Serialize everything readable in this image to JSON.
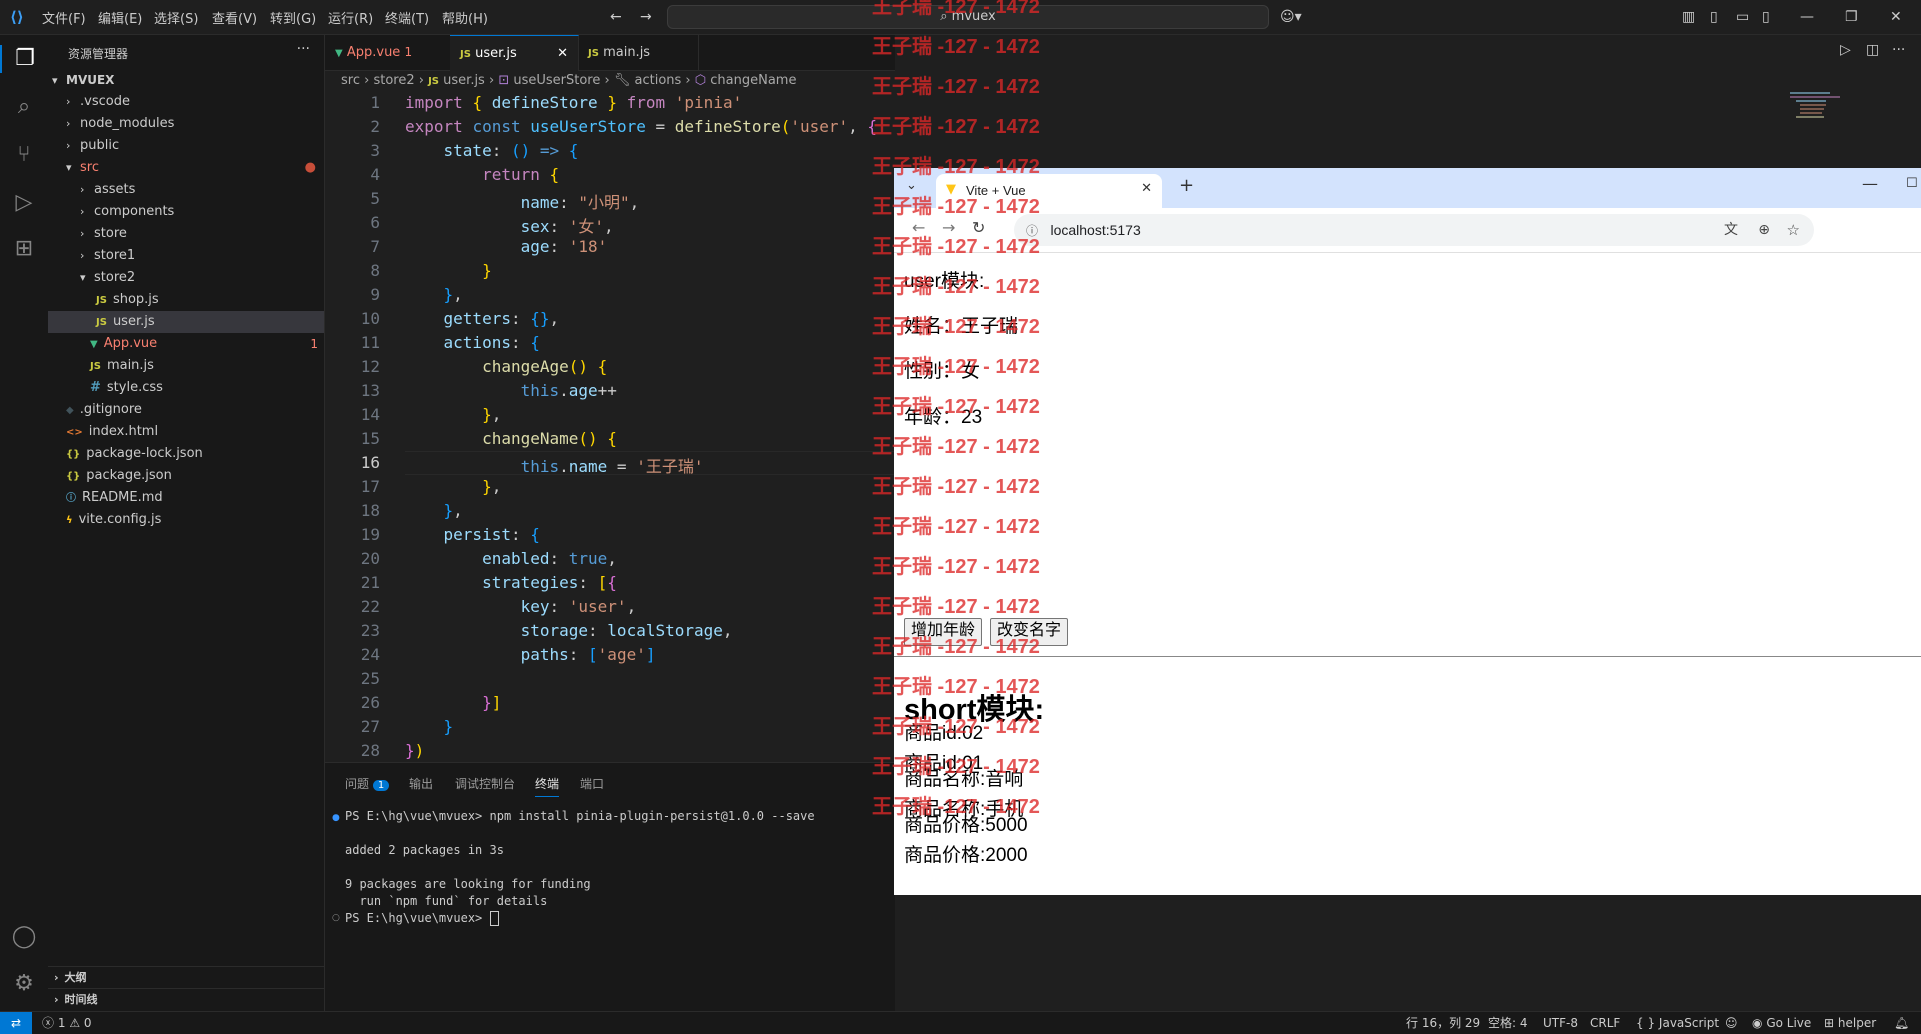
{
  "menu": [
    "文件(F)",
    "编辑(E)",
    "选择(S)",
    "查看(V)",
    "转到(G)",
    "运行(R)",
    "终端(T)",
    "帮助(H)"
  ],
  "command_center": "mvuex",
  "explorer": {
    "title": "资源管理器",
    "root": "MVUEX",
    "items": [
      {
        "label": ".vscode",
        "type": "folder"
      },
      {
        "label": "node_modules",
        "type": "folder"
      },
      {
        "label": "public",
        "type": "folder"
      },
      {
        "label": "src",
        "type": "folder-open"
      },
      {
        "label": "assets",
        "type": "folder"
      },
      {
        "label": "components",
        "type": "folder"
      },
      {
        "label": "store",
        "type": "folder"
      },
      {
        "label": "store1",
        "type": "folder"
      },
      {
        "label": "store2",
        "type": "folder-open"
      },
      {
        "label": "shop.js",
        "type": "js"
      },
      {
        "label": "user.js",
        "type": "js"
      },
      {
        "label": "App.vue",
        "type": "vue",
        "badge": "1"
      },
      {
        "label": "main.js",
        "type": "js"
      },
      {
        "label": "style.css",
        "type": "css"
      },
      {
        "label": ".gitignore",
        "type": "git"
      },
      {
        "label": "index.html",
        "type": "html"
      },
      {
        "label": "package-lock.json",
        "type": "json"
      },
      {
        "label": "package.json",
        "type": "json"
      },
      {
        "label": "README.md",
        "type": "info"
      },
      {
        "label": "vite.config.js",
        "type": "vite"
      }
    ],
    "outline": "大纲",
    "timeline": "时间线"
  },
  "tabs": [
    {
      "label": "App.vue",
      "badge": "1"
    },
    {
      "label": "user.js"
    },
    {
      "label": "main.js"
    }
  ],
  "breadcrumb": [
    "src",
    "store2",
    "user.js",
    "useUserStore",
    "actions",
    "changeName"
  ],
  "line_numbers": [
    "1",
    "2",
    "3",
    "4",
    "5",
    "6",
    "7",
    "8",
    "9",
    "10",
    "11",
    "12",
    "13",
    "14",
    "15",
    "16",
    "17",
    "18",
    "19",
    "20",
    "21",
    "22",
    "23",
    "24",
    "25",
    "26",
    "27",
    "28"
  ],
  "panel": {
    "tabs": [
      "问题",
      "输出",
      "调试控制台",
      "终端",
      "端口"
    ],
    "problems_count": "1",
    "terminal": [
      "PS E:\\hg\\vue\\mvuex> npm install pinia-plugin-persist@1.0.0 --save",
      "",
      "added 2 packages in 3s",
      "",
      "9 packages are looking for funding",
      "  run `npm fund` for details",
      "PS E:\\hg\\vue\\mvuex> "
    ]
  },
  "browser": {
    "tab_title": "Vite + Vue",
    "url": "localhost:5173",
    "user_heading": "user模块:",
    "name_line": "姓名：王子瑞",
    "sex_line": "性别：女",
    "age_line": "年龄：23",
    "btn_add_age": "增加年龄",
    "btn_change_name": "改变名字",
    "short_heading": "short模块:",
    "products": [
      "商品id:01",
      "商品名称:手机",
      "商品价格:2000",
      "商品id:02",
      "商品名称:音响",
      "商品价格:5000"
    ]
  },
  "watermark": "王子瑞 -127 - 1472",
  "status": {
    "errors": "1",
    "warnings": "0",
    "position": "行 16，列 29",
    "spaces": "空格: 4",
    "encoding": "UTF-8",
    "eol": "CRLF",
    "language": "JavaScript",
    "go_live": "Go Live",
    "helper": "helper"
  },
  "colors": {
    "accent": "#0078d4",
    "watermark": "#dc2828",
    "vue": "#41b883",
    "js": "#cbcb41"
  }
}
